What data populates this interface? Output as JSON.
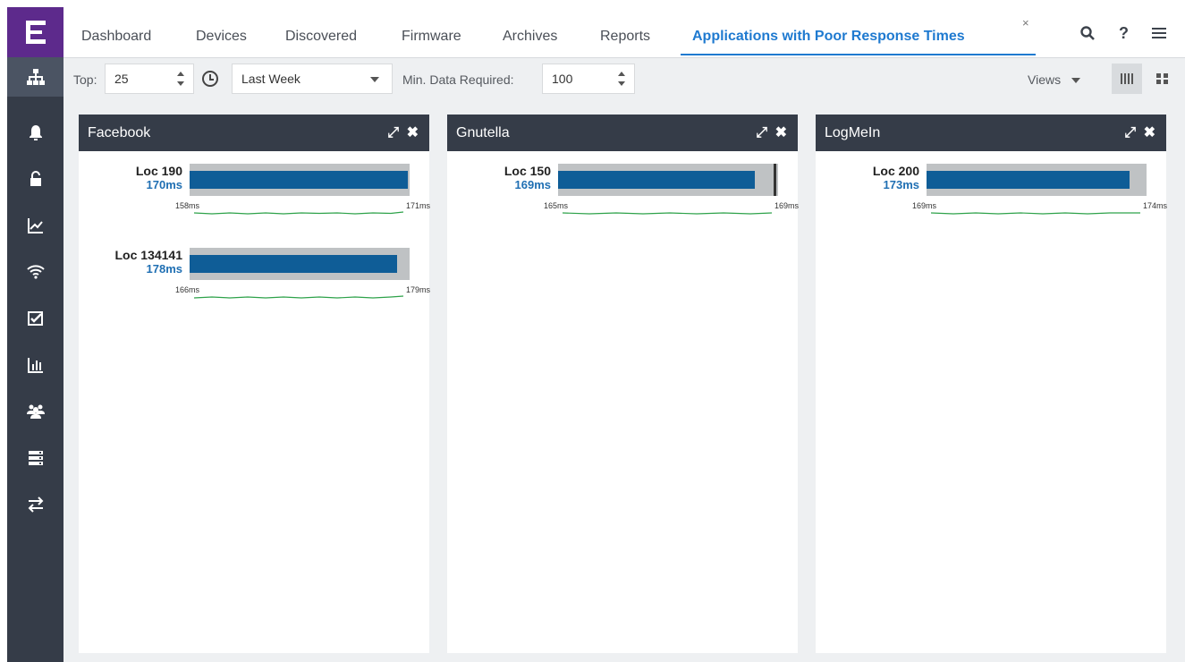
{
  "tabs": [
    {
      "label": "Dashboard",
      "active": false
    },
    {
      "label": "Devices",
      "active": false
    },
    {
      "label": "Discovered",
      "active": false
    },
    {
      "label": "Firmware",
      "active": false
    },
    {
      "label": "Archives",
      "active": false
    },
    {
      "label": "Reports",
      "active": false
    },
    {
      "label": "Applications with Poor Response Times",
      "active": true
    }
  ],
  "tab_close": "×",
  "top_icons": {
    "search": "search-icon",
    "help": "?",
    "menu": "menu-icon"
  },
  "toolbar": {
    "top_label": "Top:",
    "top_value": "25",
    "time_value": "Last Week",
    "min_label": "Min. Data Required:",
    "min_value": "100",
    "views_label": "Views"
  },
  "rail": [
    {
      "icon": "network-icon",
      "active": true
    },
    {
      "icon": "bell-icon"
    },
    {
      "icon": "lock-icon"
    },
    {
      "icon": "trend-chart-icon"
    },
    {
      "icon": "wifi-icon"
    },
    {
      "icon": "checklist-icon"
    },
    {
      "icon": "bar-chart-icon"
    },
    {
      "icon": "users-icon"
    },
    {
      "icon": "server-icon"
    },
    {
      "icon": "transfer-icon"
    }
  ],
  "colors": {
    "accent": "#1f7ad0",
    "bar": "#0f5d97",
    "header": "#353c48",
    "logo": "#5d2a8c",
    "spark": "#2ea24a"
  },
  "cards": [
    {
      "title": "Facebook",
      "entries": [
        {
          "loc": "Loc 190",
          "ms": "170ms",
          "min": "158ms",
          "max": "171ms",
          "fill_fraction": 1.0,
          "target_fraction": null
        },
        {
          "loc": "Loc 134141",
          "ms": "178ms",
          "min": "166ms",
          "max": "179ms",
          "fill_fraction": 0.95,
          "target_fraction": null
        }
      ]
    },
    {
      "title": "Gnutella",
      "entries": [
        {
          "loc": "Loc 150",
          "ms": "169ms",
          "min": "165ms",
          "max": "169ms",
          "fill_fraction": 0.9,
          "target_fraction": 0.98
        }
      ]
    },
    {
      "title": "LogMeIn",
      "entries": [
        {
          "loc": "Loc 200",
          "ms": "173ms",
          "min": "169ms",
          "max": "174ms",
          "fill_fraction": 0.93,
          "target_fraction": null
        }
      ]
    }
  ]
}
